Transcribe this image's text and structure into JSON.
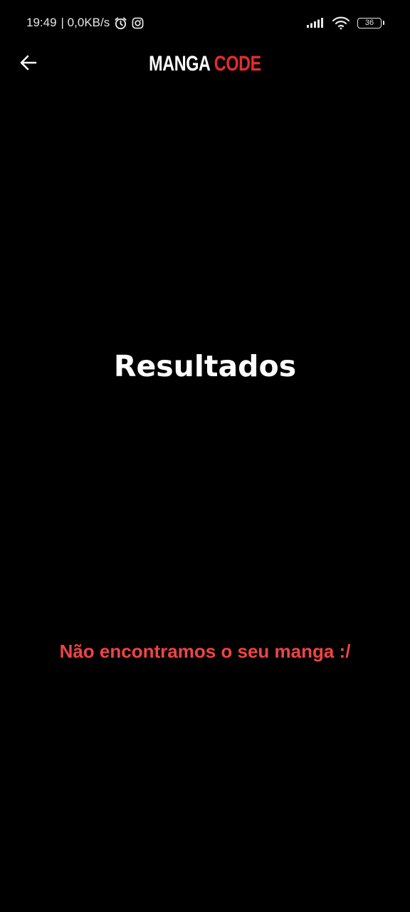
{
  "status_bar": {
    "time": "19:49",
    "network_speed": "| 0,0KB/s",
    "icons": [
      "alarm-icon",
      "instagram-icon",
      "signal-icon",
      "wifi-icon",
      "battery-icon"
    ],
    "battery_level": "36"
  },
  "app_bar": {
    "back_icon": "arrow-left-icon",
    "logo_part_1": "MANGA ",
    "logo_part_2": "CODE",
    "logo_colors": {
      "part_1": "#ffffff",
      "part_2": "#e52d2d"
    }
  },
  "main": {
    "title": "Resultados",
    "empty_message": "Não encontramos o seu manga :/"
  },
  "colors": {
    "background": "#000000",
    "title": "#ffffff",
    "error": "#ef4444"
  }
}
